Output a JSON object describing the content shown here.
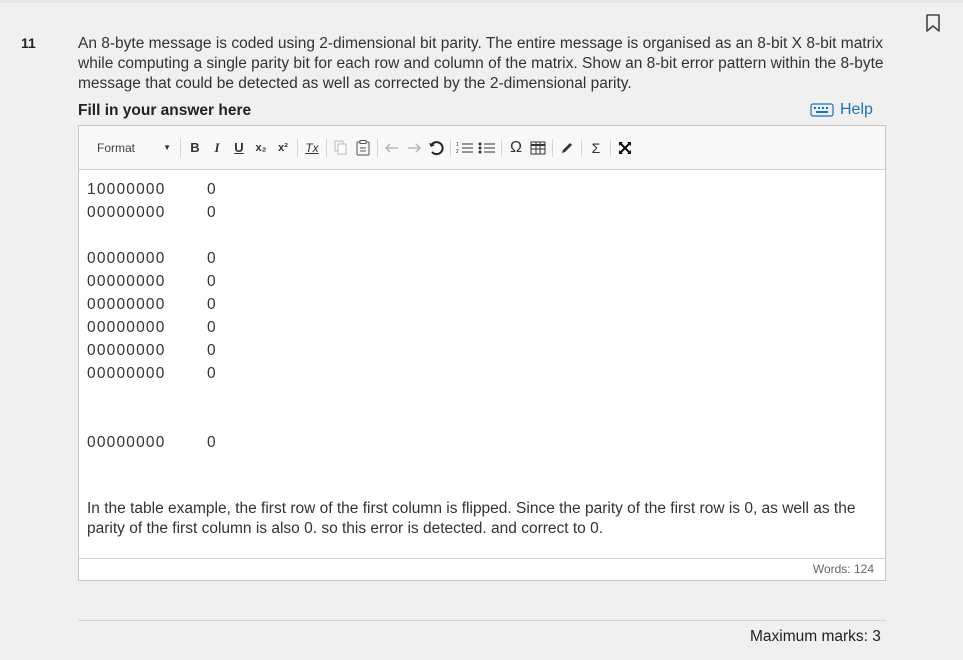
{
  "question": {
    "number": "11",
    "text": "An 8-byte message is coded using 2-dimensional bit parity. The entire message is organised as an 8-bit X 8-bit matrix while computing a single parity bit for each row and column of the matrix. Show an 8-bit error pattern within the 8-byte message that could be detected as well as corrected by the 2-dimensional parity."
  },
  "answer": {
    "label": "Fill in your answer here",
    "help_label": "Help"
  },
  "toolbar": {
    "format_label": "Format",
    "bold": "B",
    "italic": "I",
    "underline": "U",
    "subscript": "x₂",
    "superscript": "x²",
    "remove_format": "Tx",
    "omega": "Ω",
    "sigma": "Σ"
  },
  "editor": {
    "matrix_rows": [
      {
        "bits": "10000000",
        "parity": "0"
      },
      {
        "bits": "00000000",
        "parity": "0"
      },
      {
        "bits": "00000000",
        "parity": "0"
      },
      {
        "bits": "00000000",
        "parity": "0"
      },
      {
        "bits": "00000000",
        "parity": "0"
      },
      {
        "bits": "00000000",
        "parity": "0"
      },
      {
        "bits": "00000000",
        "parity": "0"
      },
      {
        "bits": "00000000",
        "parity": "0"
      },
      {
        "bits": "00000000",
        "parity": "0"
      }
    ],
    "explanation": "In the table example, the first row of the first column is flipped. Since the parity of the first row is 0, as well as the parity of the first column is also 0. so this error is detected. and correct to 0.",
    "word_count": "Words: 124"
  },
  "footer": {
    "max_marks": "Maximum marks: 3"
  }
}
